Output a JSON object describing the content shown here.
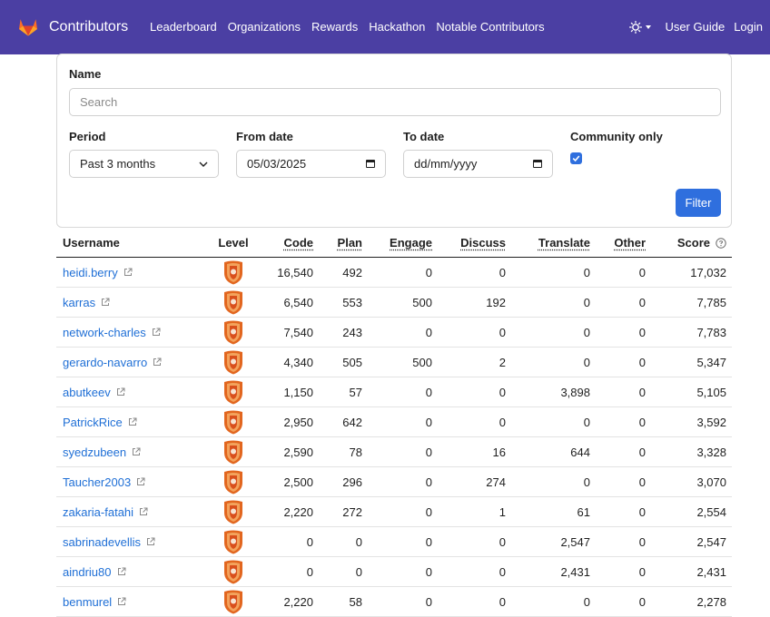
{
  "nav": {
    "brand": "Contributors",
    "links": [
      "Leaderboard",
      "Organizations",
      "Rewards",
      "Hackathon",
      "Notable Contributors"
    ],
    "user_guide": "User Guide",
    "login": "Login"
  },
  "filters": {
    "name_label": "Name",
    "search_placeholder": "Search",
    "period_label": "Period",
    "period_value": "Past 3 months",
    "from_label": "From date",
    "from_value": "05/03/2025",
    "to_label": "To date",
    "to_value": "dd/mm/yyyy",
    "community_label": "Community only",
    "community_checked": true,
    "filter_button": "Filter"
  },
  "table": {
    "headers": {
      "username": "Username",
      "level": "Level",
      "code": "Code",
      "plan": "Plan",
      "engage": "Engage",
      "discuss": "Discuss",
      "translate": "Translate",
      "other": "Other",
      "score": "Score"
    },
    "rows": [
      {
        "username": "heidi.berry",
        "code": "16,540",
        "plan": "492",
        "engage": "0",
        "discuss": "0",
        "translate": "0",
        "other": "0",
        "score": "17,032"
      },
      {
        "username": "karras",
        "code": "6,540",
        "plan": "553",
        "engage": "500",
        "discuss": "192",
        "translate": "0",
        "other": "0",
        "score": "7,785"
      },
      {
        "username": "network-charles",
        "code": "7,540",
        "plan": "243",
        "engage": "0",
        "discuss": "0",
        "translate": "0",
        "other": "0",
        "score": "7,783"
      },
      {
        "username": "gerardo-navarro",
        "code": "4,340",
        "plan": "505",
        "engage": "500",
        "discuss": "2",
        "translate": "0",
        "other": "0",
        "score": "5,347"
      },
      {
        "username": "abutkeev",
        "code": "1,150",
        "plan": "57",
        "engage": "0",
        "discuss": "0",
        "translate": "3,898",
        "other": "0",
        "score": "5,105"
      },
      {
        "username": "PatrickRice",
        "code": "2,950",
        "plan": "642",
        "engage": "0",
        "discuss": "0",
        "translate": "0",
        "other": "0",
        "score": "3,592"
      },
      {
        "username": "syedzubeen",
        "code": "2,590",
        "plan": "78",
        "engage": "0",
        "discuss": "16",
        "translate": "644",
        "other": "0",
        "score": "3,328"
      },
      {
        "username": "Taucher2003",
        "code": "2,500",
        "plan": "296",
        "engage": "0",
        "discuss": "274",
        "translate": "0",
        "other": "0",
        "score": "3,070"
      },
      {
        "username": "zakaria-fatahi",
        "code": "2,220",
        "plan": "272",
        "engage": "0",
        "discuss": "1",
        "translate": "61",
        "other": "0",
        "score": "2,554"
      },
      {
        "username": "sabrinadevellis",
        "code": "0",
        "plan": "0",
        "engage": "0",
        "discuss": "0",
        "translate": "2,547",
        "other": "0",
        "score": "2,547"
      },
      {
        "username": "aindriu80",
        "code": "0",
        "plan": "0",
        "engage": "0",
        "discuss": "0",
        "translate": "2,431",
        "other": "0",
        "score": "2,431"
      },
      {
        "username": "benmurel",
        "code": "2,220",
        "plan": "58",
        "engage": "0",
        "discuss": "0",
        "translate": "0",
        "other": "0",
        "score": "2,278"
      }
    ]
  },
  "colors": {
    "navbar": "#4b3fa3",
    "link": "#1f6fd6",
    "primary": "#2f6fde",
    "badge_orange": "#e2661f",
    "badge_light": "#f3a35c"
  },
  "icons": {
    "logo": "gitlab-tanuki-icon",
    "theme": "sun-icon",
    "external": "external-link-icon",
    "help": "question-circle-icon",
    "level": "shield-badge-icon",
    "calendar": "calendar-icon"
  }
}
